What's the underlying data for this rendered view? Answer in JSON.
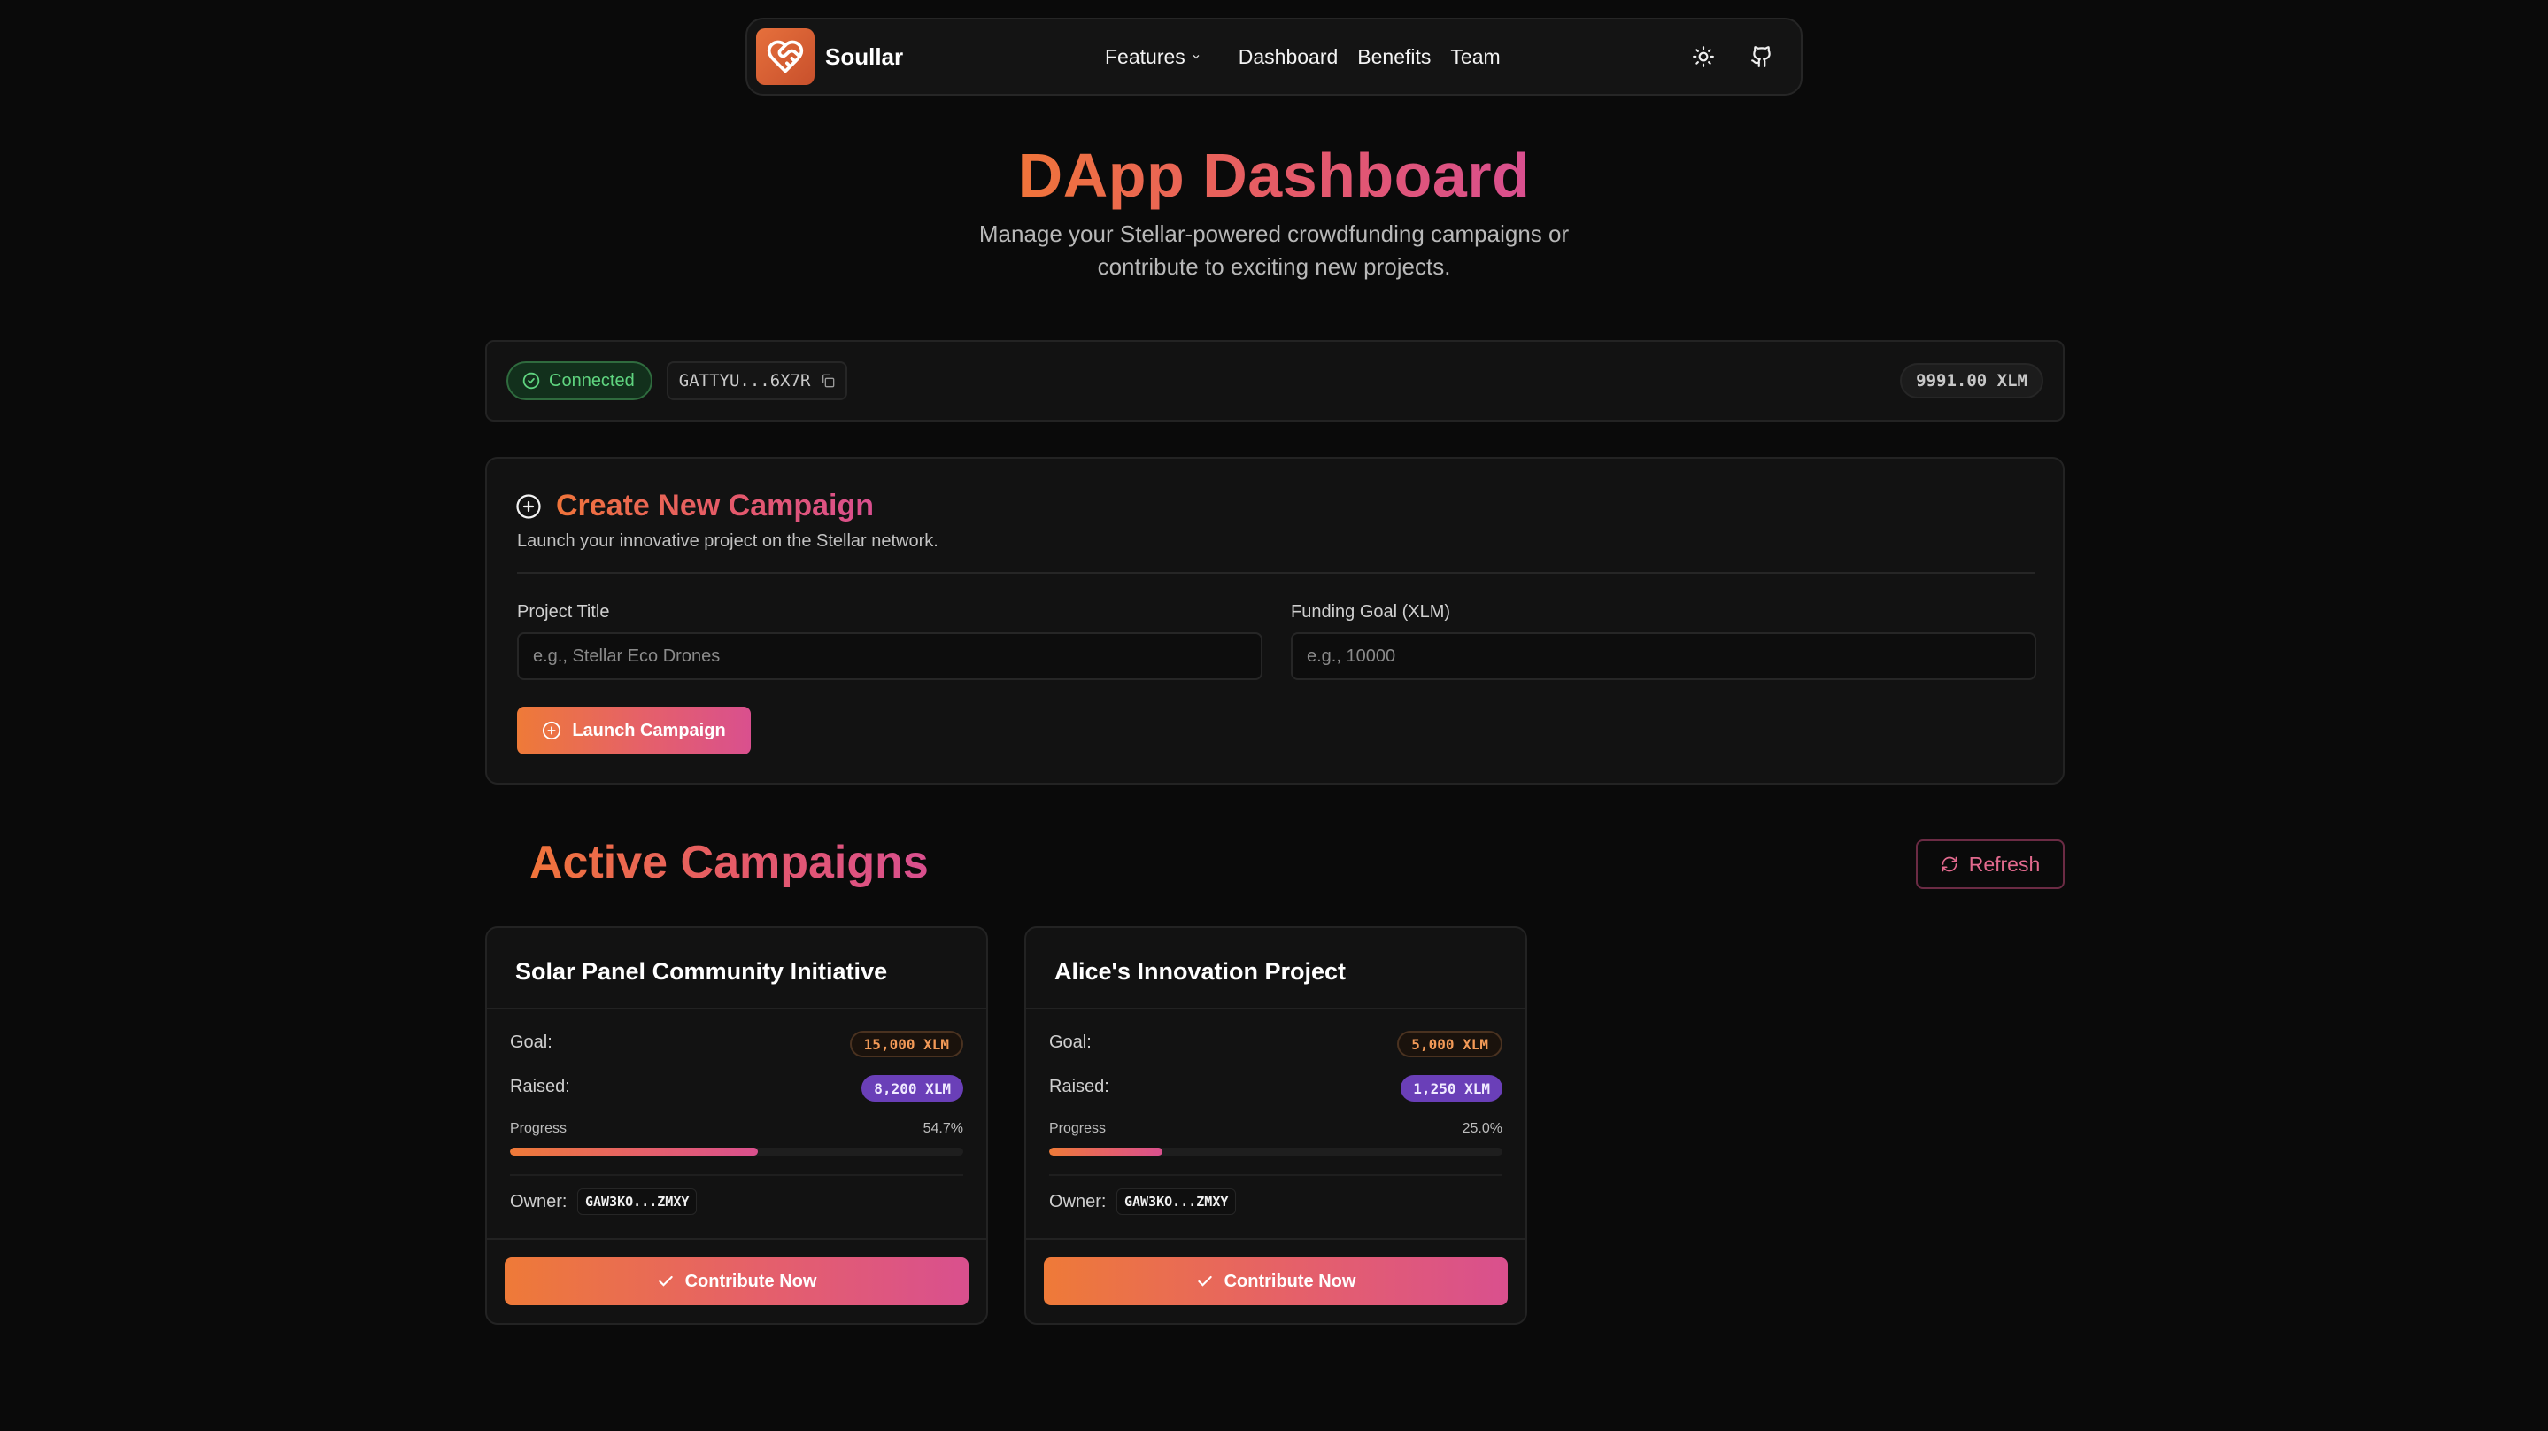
{
  "nav": {
    "brand": "Soullar",
    "links": [
      "Features",
      "Dashboard",
      "Benefits",
      "Team"
    ],
    "icons": [
      "heart-logo-icon",
      "sun-icon",
      "github-icon"
    ]
  },
  "hero": {
    "title": "DApp Dashboard",
    "subtitle": "Manage your Stellar-powered crowdfunding campaigns or contribute to exciting new projects."
  },
  "wallet": {
    "status": "Connected",
    "address": "GATTYU...6X7R",
    "balance": "9991.00 XLM"
  },
  "create": {
    "title": "Create New Campaign",
    "subtitle": "Launch your innovative project on the Stellar network.",
    "project_title_label": "Project Title",
    "project_title_placeholder": "e.g., Stellar Eco Drones",
    "goal_label": "Funding Goal (XLM)",
    "goal_placeholder": "e.g., 10000",
    "launch_label": "Launch Campaign"
  },
  "active": {
    "title": "Active Campaigns",
    "refresh_label": "Refresh"
  },
  "campaigns": [
    {
      "title": "Solar Panel Community Initiative",
      "goal_label": "Goal:",
      "goal": "15,000 XLM",
      "raised_label": "Raised:",
      "raised": "8,200 XLM",
      "progress_label": "Progress",
      "progress_text": "54.7%",
      "progress": 0.547,
      "owner_label": "Owner:",
      "owner": "GAW3KO...ZMXY",
      "cta": "Contribute Now"
    },
    {
      "title": "Alice's Innovation Project",
      "goal_label": "Goal:",
      "goal": "5,000 XLM",
      "raised_label": "Raised:",
      "raised": "1,250 XLM",
      "progress_label": "Progress",
      "progress_text": "25.0%",
      "progress": 0.25,
      "owner_label": "Owner:",
      "owner": "GAW3KO...ZMXY",
      "cta": "Contribute Now"
    }
  ],
  "colors": {
    "accent_start": "#ee7a38",
    "accent_end": "#d9508e",
    "connected_green": "#5fd47f",
    "raised_purple": "#6a3fb8",
    "goal_orange": "#f39a57"
  }
}
